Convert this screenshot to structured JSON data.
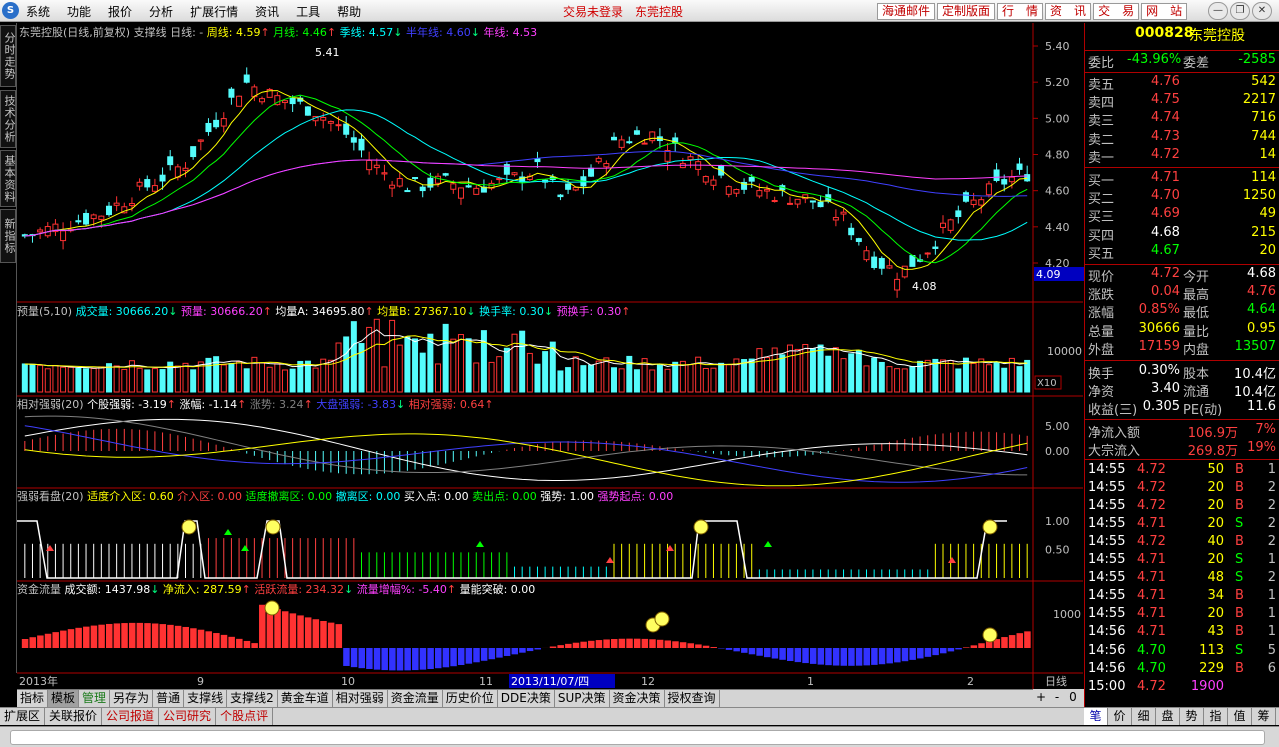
{
  "menubar": {
    "items": [
      "系统",
      "功能",
      "报价",
      "分析",
      "扩展行情",
      "资讯",
      "工具",
      "帮助"
    ],
    "login": [
      "交易未登录",
      "东莞控股"
    ],
    "buttons": [
      "海通邮件",
      "定制版面",
      "行　情",
      "资　讯",
      "交　易",
      "网　站"
    ]
  },
  "left_tabs": [
    "分时走势",
    "技术分析",
    "基本资料",
    "新指标"
  ],
  "main_chart": {
    "title": "东莞控股(日线,前复权) 支撑线",
    "day_label": "日线: -",
    "ma": [
      {
        "label": "周线: 4.59",
        "arrow": "↑",
        "color": "#ffff00"
      },
      {
        "label": "月线: 4.46",
        "arrow": "↑",
        "color": "#00ff00"
      },
      {
        "label": "季线: 4.57",
        "arrow": "↓",
        "color": "#00ffff"
      },
      {
        "label": "半年线: 4.60",
        "arrow": "↓",
        "color": "#4040ff"
      },
      {
        "label": "年线: 4.53",
        "arrow": "",
        "color": "#ff40ff"
      }
    ],
    "y_ticks": [
      "5.40",
      "5.20",
      "5.00",
      "4.80",
      "4.60",
      "4.40",
      "4.20"
    ],
    "high_label": "5.41",
    "low_label": "4.08",
    "cursor_price": "4.09"
  },
  "volume_panel": {
    "title": "预量(5,10)",
    "items": [
      {
        "text": "成交量: 30666.20",
        "arrow": "↓",
        "color": "#00ffff"
      },
      {
        "text": "预量: 30666.20",
        "arrow": "↑",
        "color": "#ff40ff"
      },
      {
        "text": "均量A: 34695.80",
        "arrow": "↑",
        "color": "#ffffff"
      },
      {
        "text": "均量B: 27367.10",
        "arrow": "↓",
        "color": "#ffff00"
      },
      {
        "text": "换手率: 0.30",
        "arrow": "↓",
        "color": "#00ffff"
      },
      {
        "text": "预换手: 0.30",
        "arrow": "↑",
        "color": "#ff40ff"
      }
    ],
    "y_tick": "10000",
    "unit": "X10"
  },
  "rs_panel": {
    "title": "相对强弱(20)",
    "items": [
      {
        "text": "个股强弱: -3.19",
        "arrow": "↑",
        "color": "#ffffff"
      },
      {
        "text": "涨幅: -1.14",
        "arrow": "↑",
        "color": "#ffffff"
      },
      {
        "text": "涨势: 3.24",
        "arrow": "↑",
        "color": "#808080"
      },
      {
        "text": "大盘强弱: -3.83",
        "arrow": "↓",
        "color": "#4040ff"
      },
      {
        "text": "相对强弱: 0.64",
        "arrow": "↑",
        "color": "#ff4040"
      }
    ],
    "y_ticks": [
      "5.00",
      "0.00"
    ]
  },
  "strength_panel": {
    "title": "强弱看盘(20)",
    "items": [
      {
        "text": "适度介入区: 0.60",
        "color": "#ffff00"
      },
      {
        "text": "介入区: 0.00",
        "color": "#ff4040"
      },
      {
        "text": "适度撤离区: 0.00",
        "color": "#00ff00"
      },
      {
        "text": "撤离区: 0.00",
        "color": "#00ffff"
      },
      {
        "text": "买入点: 0.00",
        "color": "#ffffff"
      },
      {
        "text": "卖出点: 0.00",
        "color": "#00ff00"
      },
      {
        "text": "强势: 1.00",
        "color": "#ffffff"
      },
      {
        "text": "强势起点: 0.00",
        "color": "#ff40ff"
      }
    ],
    "y_ticks": [
      "1.00",
      "0.50"
    ]
  },
  "flow_panel": {
    "title": "资金流量",
    "items": [
      {
        "text": "成交额: 1437.98",
        "arrow": "↓",
        "color": "#ffffff"
      },
      {
        "text": "净流入: 287.59",
        "arrow": "↑",
        "color": "#ffff00"
      },
      {
        "text": "活跃流量: 234.32",
        "arrow": "↓",
        "color": "#ff4040"
      },
      {
        "text": "流量增幅%: -5.40",
        "arrow": "↑",
        "color": "#ff40ff"
      },
      {
        "text": "量能突破: 0.00",
        "arrow": "",
        "color": "#ffffff"
      }
    ],
    "y_tick": "1000"
  },
  "x_axis": {
    "labels": [
      "2013年",
      "9",
      "10",
      "11",
      "12",
      "1",
      "2"
    ],
    "cursor_date": "2013/11/07/四",
    "period": "日线"
  },
  "bottom_tabs": [
    "指标",
    "模板",
    "管理",
    "另存为",
    "普通",
    "支撑线",
    "支撑线2",
    "黄金车道",
    "相对强弱",
    "资金流量",
    "历史价位",
    "DDE决策",
    "SUP决策",
    "资金决策",
    "授权查询"
  ],
  "zoom_controls": [
    "+",
    "-",
    "0"
  ],
  "bottom_tabs2": [
    "扩展区",
    "关联报价",
    "公司报道",
    "公司研究",
    "个股点评"
  ],
  "quote": {
    "code": "000828",
    "name": "东莞控股",
    "weibi_label": "委比",
    "weibi": "-43.96%",
    "weicha_label": "委差",
    "weicha": "-2585",
    "asks": [
      {
        "label": "卖五",
        "price": "4.76",
        "vol": "542"
      },
      {
        "label": "卖四",
        "price": "4.75",
        "vol": "2217"
      },
      {
        "label": "卖三",
        "price": "4.74",
        "vol": "716"
      },
      {
        "label": "卖二",
        "price": "4.73",
        "vol": "744"
      },
      {
        "label": "卖一",
        "price": "4.72",
        "vol": "14"
      }
    ],
    "bids": [
      {
        "label": "买一",
        "price": "4.71",
        "vol": "114"
      },
      {
        "label": "买二",
        "price": "4.70",
        "vol": "1250"
      },
      {
        "label": "买三",
        "price": "4.69",
        "vol": "49"
      },
      {
        "label": "买四",
        "price": "4.68",
        "vol": "215"
      },
      {
        "label": "买五",
        "price": "4.67",
        "vol": "20"
      }
    ],
    "stats": [
      [
        "现价",
        "4.72",
        "今开",
        "4.68"
      ],
      [
        "涨跌",
        "0.04",
        "最高",
        "4.76"
      ],
      [
        "涨幅",
        "0.85%",
        "最低",
        "4.64"
      ],
      [
        "总量",
        "30666",
        "量比",
        "0.95"
      ],
      [
        "外盘",
        "17159",
        "内盘",
        "13507"
      ]
    ],
    "stats2": [
      [
        "换手",
        "0.30%",
        "股本",
        "10.4亿"
      ],
      [
        "净资",
        "3.40",
        "流通",
        "10.4亿"
      ],
      [
        "收益(三)",
        "0.305",
        "PE(动)",
        "11.6"
      ]
    ],
    "flow": [
      [
        "净流入额",
        "106.9万",
        "7%"
      ],
      [
        "大宗流入",
        "269.8万",
        "19%"
      ]
    ],
    "ticks": [
      [
        "14:55",
        "4.72",
        "50",
        "B",
        "1"
      ],
      [
        "14:55",
        "4.72",
        "20",
        "B",
        "2"
      ],
      [
        "14:55",
        "4.72",
        "20",
        "B",
        "2"
      ],
      [
        "14:55",
        "4.71",
        "20",
        "S",
        "2"
      ],
      [
        "14:55",
        "4.72",
        "40",
        "B",
        "2"
      ],
      [
        "14:55",
        "4.71",
        "20",
        "S",
        "1"
      ],
      [
        "14:55",
        "4.71",
        "48",
        "S",
        "2"
      ],
      [
        "14:55",
        "4.71",
        "34",
        "B",
        "1"
      ],
      [
        "14:55",
        "4.71",
        "20",
        "B",
        "1"
      ],
      [
        "14:56",
        "4.71",
        "43",
        "B",
        "1"
      ],
      [
        "14:56",
        "4.70",
        "113",
        "S",
        "5"
      ],
      [
        "14:56",
        "4.70",
        "229",
        "B",
        "6"
      ],
      [
        "15:00",
        "4.72",
        "1900",
        "",
        " "
      ]
    ]
  },
  "right_tabs": [
    "笔",
    "价",
    "细",
    "盘",
    "势",
    "指",
    "值",
    "筹"
  ]
}
